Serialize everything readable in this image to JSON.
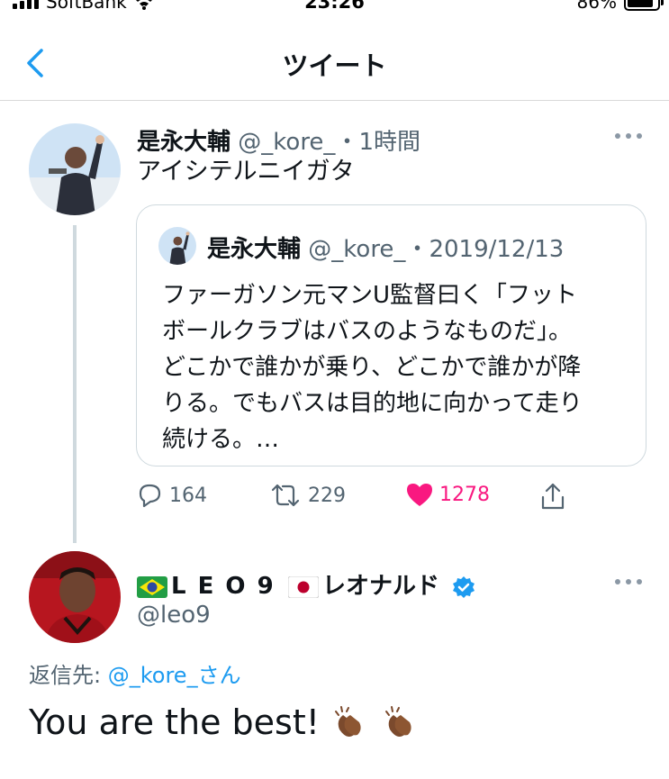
{
  "status_bar": {
    "carrier": "SoftBank",
    "time": "23:26",
    "battery_text": "86%",
    "battery_level": 0.86
  },
  "nav": {
    "title": "ツイート",
    "back_icon": "chevron-left-icon"
  },
  "tweet": {
    "author_name": "是永大輔",
    "handle": "@_kore_",
    "time": "・1時間",
    "text": "アイシテルニイガタ",
    "quote": {
      "author_name": "是永大輔",
      "handle": "@_kore_",
      "date": "・2019/12/13",
      "text_lines": [
        "ファーガソン元マンU監督曰く「フット",
        "ボールクラブはバスのようなものだ」。",
        "どこかで誰かが乗り、どこかで誰かが降",
        "りる。でもバスは目的地に向かって走り",
        "続ける。…"
      ]
    },
    "actions": {
      "reply_count": "164",
      "retweet_count": "229",
      "like_count": "1278"
    }
  },
  "reply": {
    "author_name": "L E O 9",
    "author_suffix": "レオナルド",
    "handle": "@leo9",
    "reply_to_label": "返信先:",
    "reply_to_mention": "@_kore_さん",
    "text": "You are the best!",
    "flags": [
      "flag-brazil",
      "flag-japan"
    ]
  },
  "colors": {
    "accent": "#1d9bf0",
    "like": "#f91880",
    "muted": "#536471",
    "divider": "#cfd9de"
  }
}
